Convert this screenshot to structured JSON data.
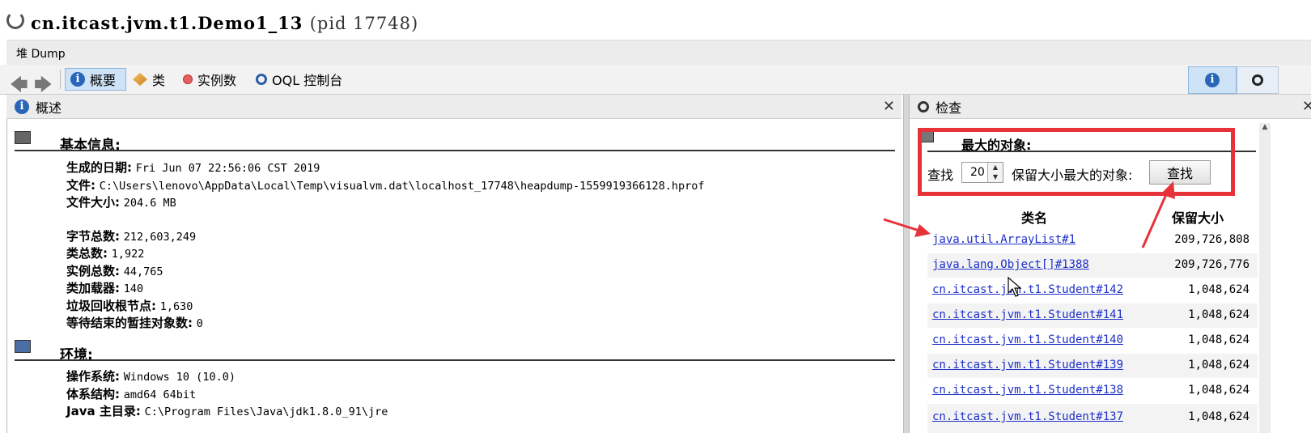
{
  "window": {
    "title": "cn.itcast.jvm.t1.Demo1_13",
    "pid": "(pid 17748)"
  },
  "heap_tab": {
    "label": "堆 Dump"
  },
  "toolbar": {
    "summary_label": "概要",
    "classes_label": "类",
    "instances_label": "实例数",
    "oql_label": "OQL 控制台"
  },
  "left_panel": {
    "header": "概述",
    "basic_info": {
      "title": "基本信息:",
      "generated_label": "生成的日期:",
      "generated_value": "Fri Jun 07 22:56:06 CST 2019",
      "file_label": "文件:",
      "file_value": "C:\\Users\\lenovo\\AppData\\Local\\Temp\\visualvm.dat\\localhost_17748\\heapdump-1559919366128.hprof",
      "file_size_label": "文件大小:",
      "file_size_value": "204.6 MB",
      "total_bytes_label": "字节总数:",
      "total_bytes_value": "212,603,249",
      "total_classes_label": "类总数:",
      "total_classes_value": "1,922",
      "total_instances_label": "实例总数:",
      "total_instances_value": "44,765",
      "classloaders_label": "类加载器:",
      "classloaders_value": "140",
      "gc_roots_label": "垃圾回收根节点:",
      "gc_roots_value": "1,630",
      "pending_finalization_label": "等待结束的暂挂对象数:",
      "pending_finalization_value": "0"
    },
    "environment": {
      "title": "环境:",
      "os_label": "操作系统:",
      "os_value": "Windows 10 (10.0)",
      "arch_label": "体系结构:",
      "arch_value": "amd64 64bit",
      "java_home_label": "Java 主目录:",
      "java_home_value": "C:\\Program Files\\Java\\jdk1.8.0_91\\jre"
    }
  },
  "right_panel": {
    "header": "检查",
    "biggest_title": "最大的对象:",
    "find_label": "查找",
    "find_count": "20",
    "retained_label": "保留大小最大的对象:",
    "find_button": "查找",
    "col_class": "类名",
    "col_retained": "保留大小",
    "rows": [
      {
        "name": "java.util.ArrayList#1",
        "size": "209,726,808"
      },
      {
        "name": "java.lang.Object[]#1388",
        "size": "209,726,776"
      },
      {
        "name": "cn.itcast.jvm.t1.Student#142",
        "size": "1,048,624"
      },
      {
        "name": "cn.itcast.jvm.t1.Student#141",
        "size": "1,048,624"
      },
      {
        "name": "cn.itcast.jvm.t1.Student#140",
        "size": "1,048,624"
      },
      {
        "name": "cn.itcast.jvm.t1.Student#139",
        "size": "1,048,624"
      },
      {
        "name": "cn.itcast.jvm.t1.Student#138",
        "size": "1,048,624"
      },
      {
        "name": "cn.itcast.jvm.t1.Student#137",
        "size": "1,048,624"
      }
    ]
  },
  "colors": {
    "highlight": "#e8323a",
    "link": "#1d2fc8",
    "active_button": "#cfe3f7"
  }
}
